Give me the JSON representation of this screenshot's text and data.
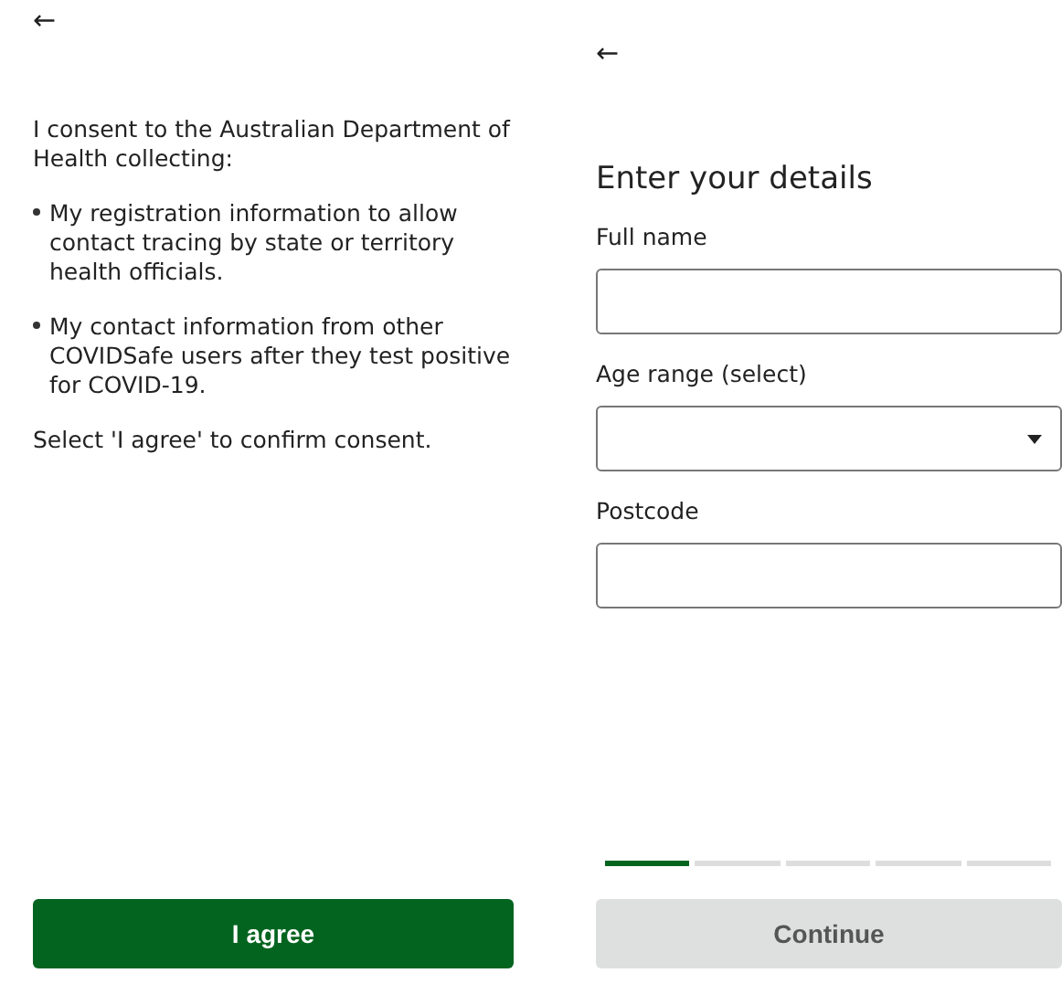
{
  "consent_screen": {
    "back": "←",
    "intro": "I consent to the Australian Department of Health collecting:",
    "bullets": [
      "My registration information to allow contact tracing by state or territory health officials.",
      "My contact information from other COVIDSafe users after they test positive for COVID-19."
    ],
    "instruction": "Select 'I agree' to confirm consent.",
    "button": {
      "label": "I agree",
      "disabled": false
    }
  },
  "details_screen": {
    "back": "←",
    "title": "Enter your details",
    "fields": [
      {
        "label": "Full name",
        "kind": "text"
      },
      {
        "label": "Age range (select)",
        "kind": "dropdown"
      },
      {
        "label": "Postcode",
        "kind": "text"
      }
    ],
    "steps": [
      {
        "selected": true
      },
      {
        "selected": false
      },
      {
        "selected": false
      },
      {
        "selected": false
      },
      {
        "selected": false
      }
    ],
    "button": {
      "label": "Continue",
      "disabled": true
    }
  }
}
